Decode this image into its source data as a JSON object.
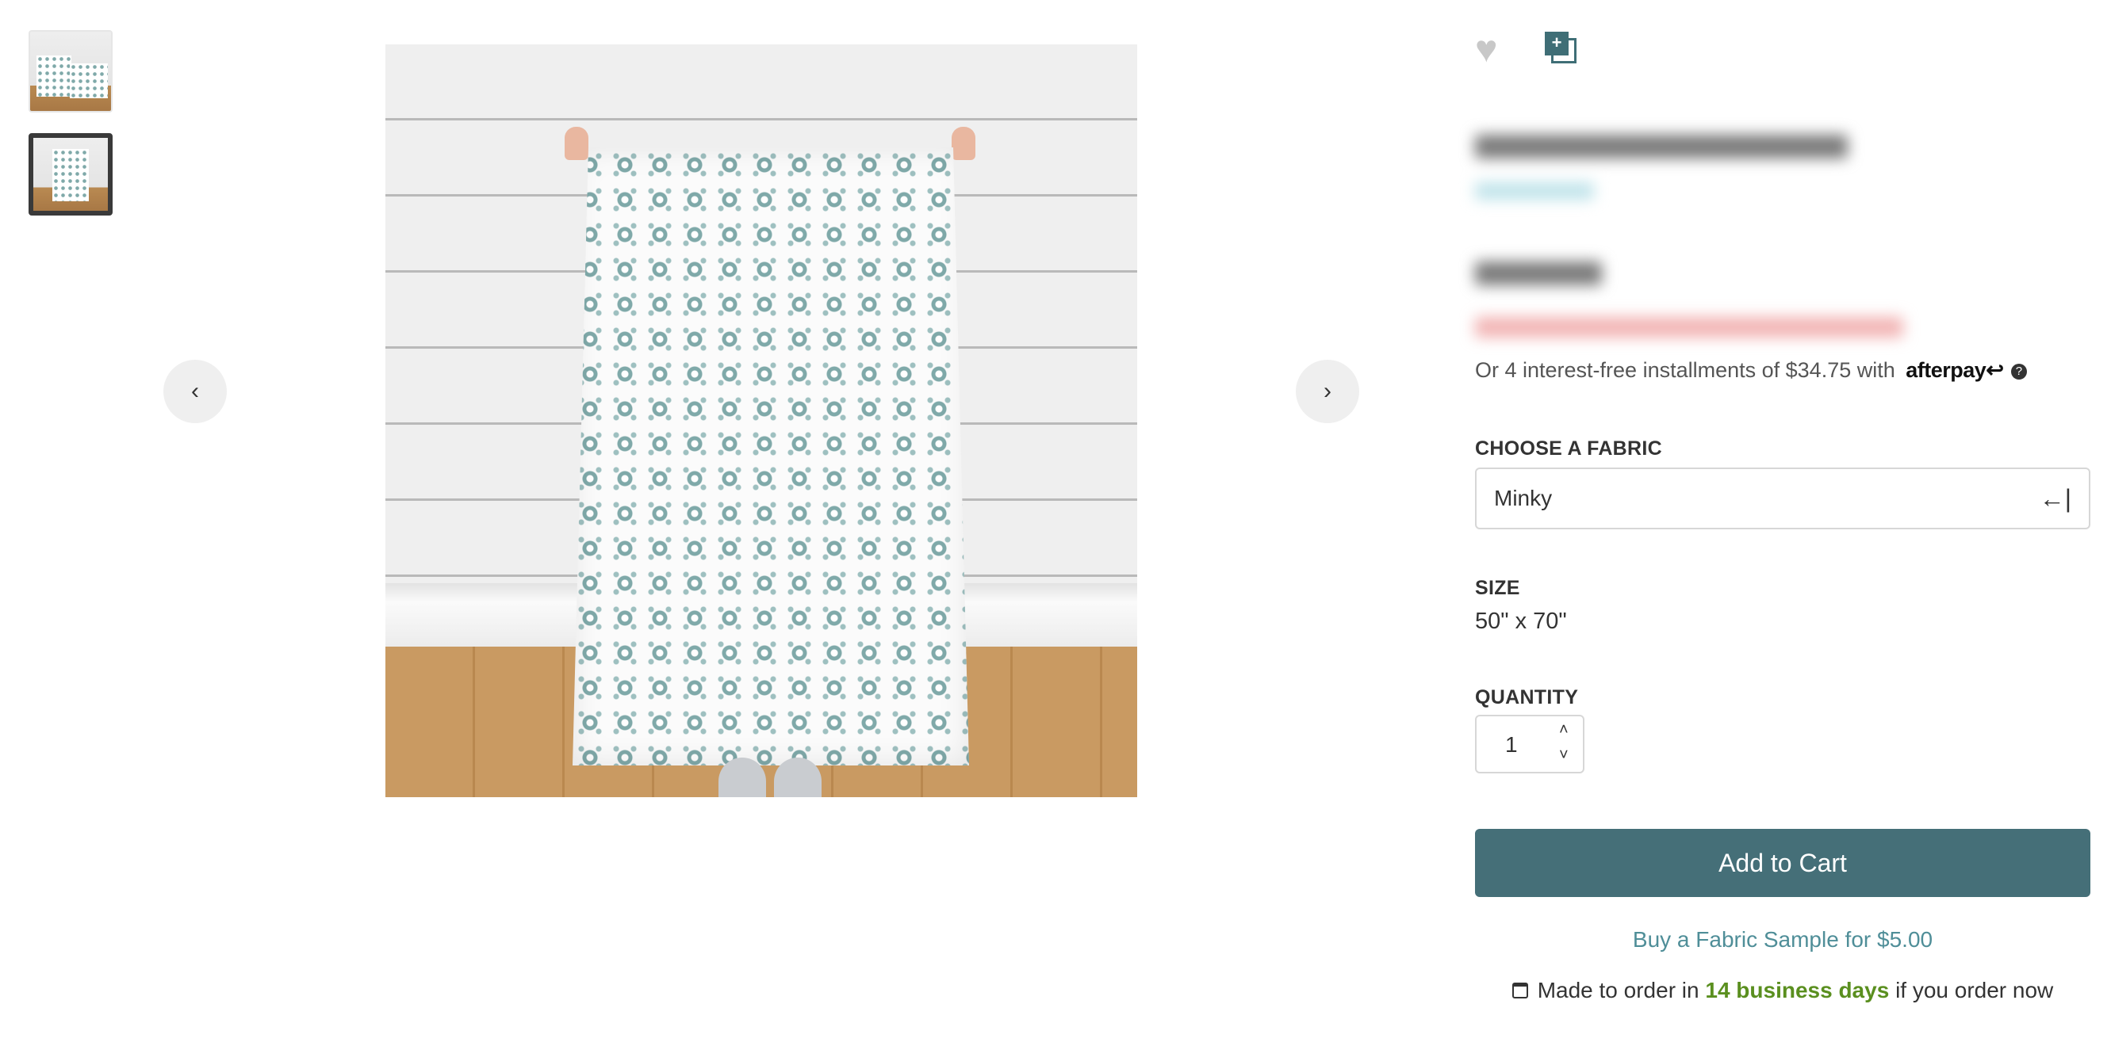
{
  "gallery": {
    "thumbnails": [
      "thumbnail-1",
      "thumbnail-2"
    ],
    "selected_index": 1,
    "prev_icon": "chevron-left-icon",
    "next_icon": "chevron-right-icon",
    "prev_glyph": "‹",
    "next_glyph": "›"
  },
  "actions": {
    "favorite_icon": "heart-icon",
    "collection_icon": "add-to-collection-icon",
    "favorite_glyph": "♥",
    "collection_glyph": "+"
  },
  "installments": {
    "text": "Or 4 interest-free installments of $34.75 with",
    "brand": "afterpay↩",
    "help_glyph": "?"
  },
  "fabric": {
    "label": "CHOOSE A FABRIC",
    "value": "Minky",
    "icon_glyph": "←|"
  },
  "size": {
    "label": "SIZE",
    "value": "50\" x 70\""
  },
  "quantity": {
    "label": "QUANTITY",
    "value": "1",
    "up_glyph": "˄",
    "down_glyph": "˅"
  },
  "add_to_cart": "Add to Cart",
  "sample_link": "Buy a Fabric Sample for $5.00",
  "made_to_order": {
    "prefix": "Made to order in",
    "days": "14 business days",
    "suffix": "if you order now"
  },
  "colors": {
    "primary": "#456f78",
    "link": "#4f8e98",
    "success": "#5a8f1f"
  }
}
